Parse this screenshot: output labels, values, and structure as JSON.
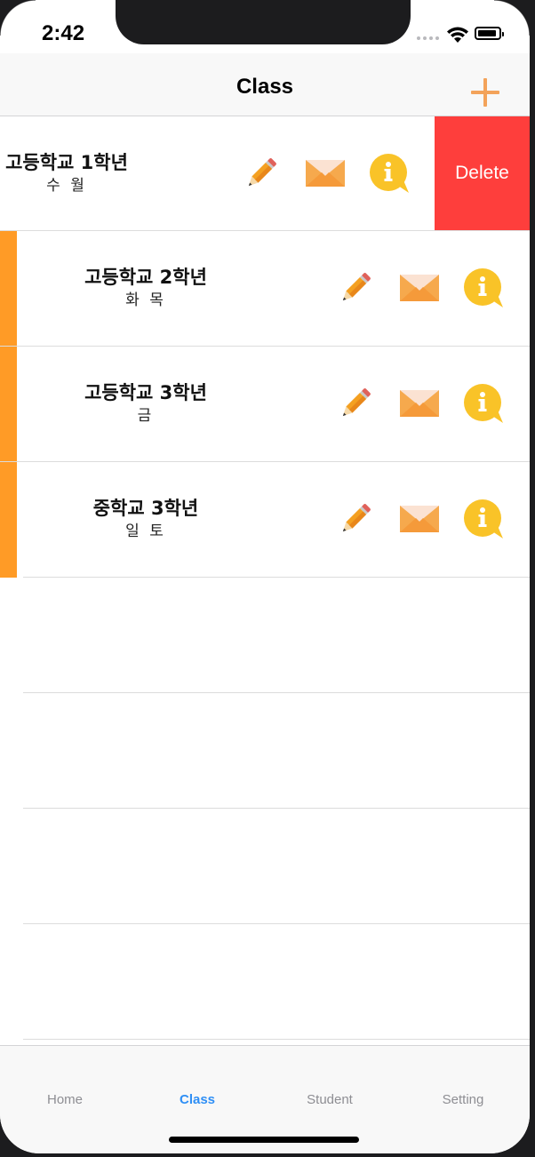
{
  "status_bar": {
    "time": "2:42"
  },
  "nav": {
    "title": "Class",
    "add_icon": "plus-icon"
  },
  "rows": [
    {
      "title": "고등학교 1학년",
      "days": "수 월"
    },
    {
      "title": "고등학교 2학년",
      "days": "화 목"
    },
    {
      "title": "고등학교 3학년",
      "days": "금"
    },
    {
      "title": "중학교 3학년",
      "days": "일 토"
    }
  ],
  "row_icons": [
    "pencil-icon",
    "envelope-icon",
    "info-icon"
  ],
  "delete_label": "Delete",
  "tabs": [
    {
      "label": "Home",
      "active": false
    },
    {
      "label": "Class",
      "active": true
    },
    {
      "label": "Student",
      "active": false
    },
    {
      "label": "Setting",
      "active": false
    }
  ],
  "colors": {
    "accent_orange": "#ff9b26",
    "add_icon": "#f3a35a",
    "delete_red": "#fe3e3c",
    "tab_active": "#2f8ff5",
    "tab_inactive": "#8e8e93",
    "info_yellow": "#f9c328"
  }
}
